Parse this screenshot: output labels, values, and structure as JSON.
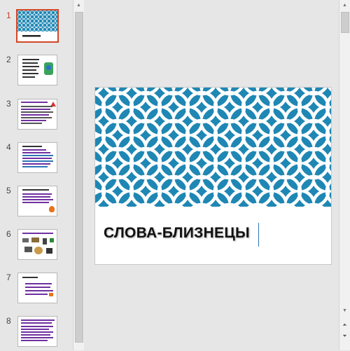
{
  "thumbnails": [
    {
      "number": "1",
      "selected": true
    },
    {
      "number": "2",
      "selected": false
    },
    {
      "number": "3",
      "selected": false
    },
    {
      "number": "4",
      "selected": false
    },
    {
      "number": "5",
      "selected": false
    },
    {
      "number": "6",
      "selected": false
    },
    {
      "number": "7",
      "selected": false
    },
    {
      "number": "8",
      "selected": false
    }
  ],
  "slide": {
    "title": "СЛОВА-БЛИЗНЕЦЫ",
    "pattern_color": "#1f87b4",
    "pattern_line_color": "#ffffff"
  },
  "scrollbar_icons": {
    "up": "triangle-up-icon",
    "down": "triangle-down-icon",
    "prev_slide": "double-chevron-up-icon",
    "next_slide": "double-chevron-down-icon"
  },
  "colors": {
    "selection_border": "#d24726",
    "active_number": "#c43e1c",
    "cursor": "#2e75b6"
  }
}
